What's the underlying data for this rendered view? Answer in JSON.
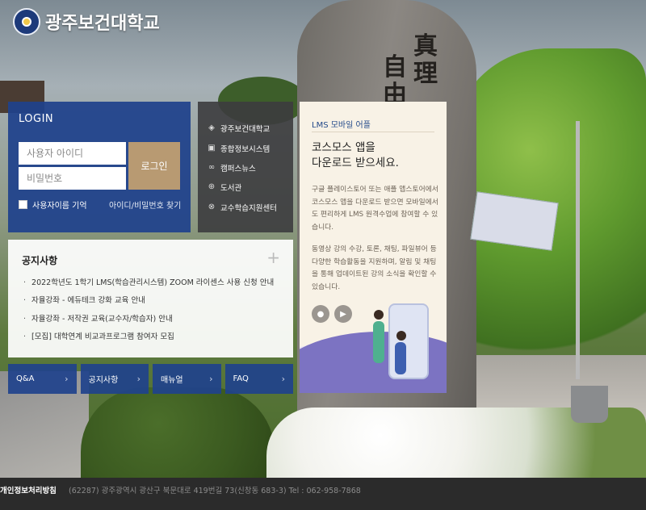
{
  "header": {
    "logo_text": "광주보건대학교"
  },
  "login": {
    "title": "LOGIN",
    "username_placeholder": "사용자 아이디",
    "password_placeholder": "비밀번호",
    "login_button": "로그인",
    "remember_label": "사용자이름 기억",
    "find_link": "아이디/비밀번호 찾기"
  },
  "quicklinks": {
    "items": [
      {
        "label": "광주보건대학교",
        "icon": "building-icon"
      },
      {
        "label": "종합정보시스템",
        "icon": "monitor-icon"
      },
      {
        "label": "캠퍼스뉴스",
        "icon": "link-icon"
      },
      {
        "label": "도서관",
        "icon": "crosshair-icon"
      },
      {
        "label": "교수학습지원센터",
        "icon": "globe-icon"
      }
    ]
  },
  "notice": {
    "title": "공지사항",
    "items": [
      "2022학년도 1학기 LMS(학습관리시스템) ZOOM 라이센스 사용 신청 안내",
      "자율강좌 - 에듀테크 강화 교육 안내",
      "자율강좌 - 저작권 교육(교수자/학습자) 안내",
      "[모집] 대학연계 비교과프로그램 참여자 모집"
    ]
  },
  "bottom_buttons": [
    "Q&A",
    "공지사항",
    "매뉴얼",
    "FAQ"
  ],
  "app_panel": {
    "title": "LMS 모바일 어플",
    "headline_1": "코스모스 앱을",
    "headline_2": "다운로드 받으세요.",
    "para_1": "구글 플레이스토어 또는 애플 앱스토어에서 코스모스 앱을 다운로드 받으면 모바일에서도 편리하게 LMS 원격수업에 참여할 수 있습니다.",
    "para_2": "동영상 강의 수강, 토론, 채팅, 파일뷰어 등 다양한 학습활동을 지원하며, 알림 및 채팅을 통해 업데이트된 강의 소식을 확인할 수 있습니다."
  },
  "background": {
    "stone_chars": [
      "真",
      "理",
      "自",
      "由"
    ]
  },
  "footer": {
    "policy": "개인정보처리방침",
    "address": "(62287) 광주광역시 광산구 북문대로 419번길 73(신창동 683-3) Tel : 062-958-7868"
  }
}
